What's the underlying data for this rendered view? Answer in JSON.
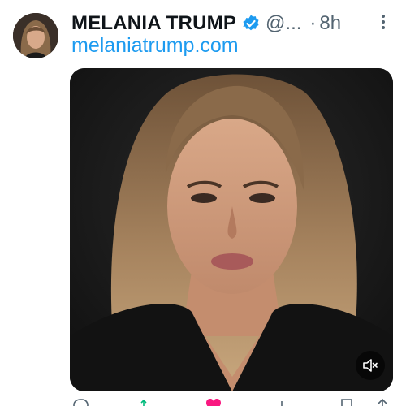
{
  "tweet": {
    "display_name": "MELANIA TRUMP",
    "handle": "@...",
    "separator": "·",
    "timestamp": "8h",
    "link_text": "melaniatrump.com",
    "media_type": "video"
  },
  "icons": {
    "verified": "verified-badge-icon",
    "more": "more-vertical-icon",
    "mute": "volume-muted-icon",
    "reply": "reply-icon",
    "retweet": "retweet-icon",
    "like": "heart-icon",
    "views": "views-icon",
    "bookmark": "bookmark-icon",
    "share": "share-icon"
  },
  "colors": {
    "name": "#0f1419",
    "secondary": "#536471",
    "link": "#1d9bf0",
    "verified": "#1d9bf0",
    "like": "#f91880",
    "retweet": "#00ba7c"
  }
}
